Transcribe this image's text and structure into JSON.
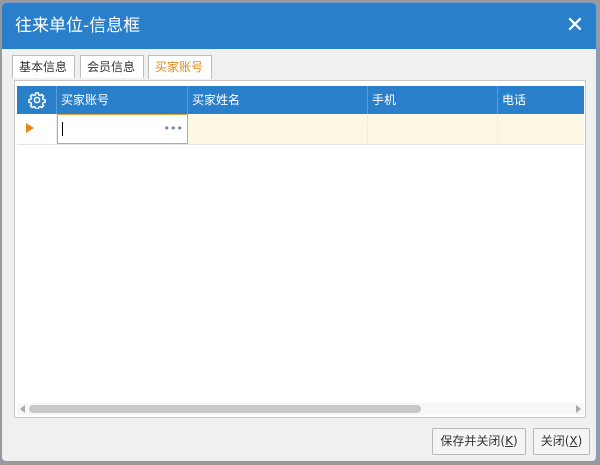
{
  "dialog": {
    "title": "往来单位-信息框",
    "close_glyph": "✕"
  },
  "tabs": [
    {
      "label": "基本信息",
      "active": false
    },
    {
      "label": "会员信息",
      "active": false
    },
    {
      "label": "买家账号",
      "active": true
    }
  ],
  "grid": {
    "settings_icon": "gear-icon",
    "columns": [
      "买家账号",
      "买家姓名",
      "手机",
      "电话"
    ],
    "rows": [
      {
        "buyer_account": "",
        "buyer_name": "",
        "mobile": "",
        "phone": "",
        "selected": true
      }
    ],
    "picker_glyph": "•••"
  },
  "buttons": {
    "save_close_prefix": "保存并关闭(",
    "save_close_key": "K",
    "save_close_suffix": ")",
    "close_prefix": "关闭(",
    "close_key": "X",
    "close_suffix": ")"
  },
  "colors": {
    "accent": "#2a7fcb",
    "active_tab": "#e08a1e",
    "row_highlight": "#fdf8e1"
  }
}
